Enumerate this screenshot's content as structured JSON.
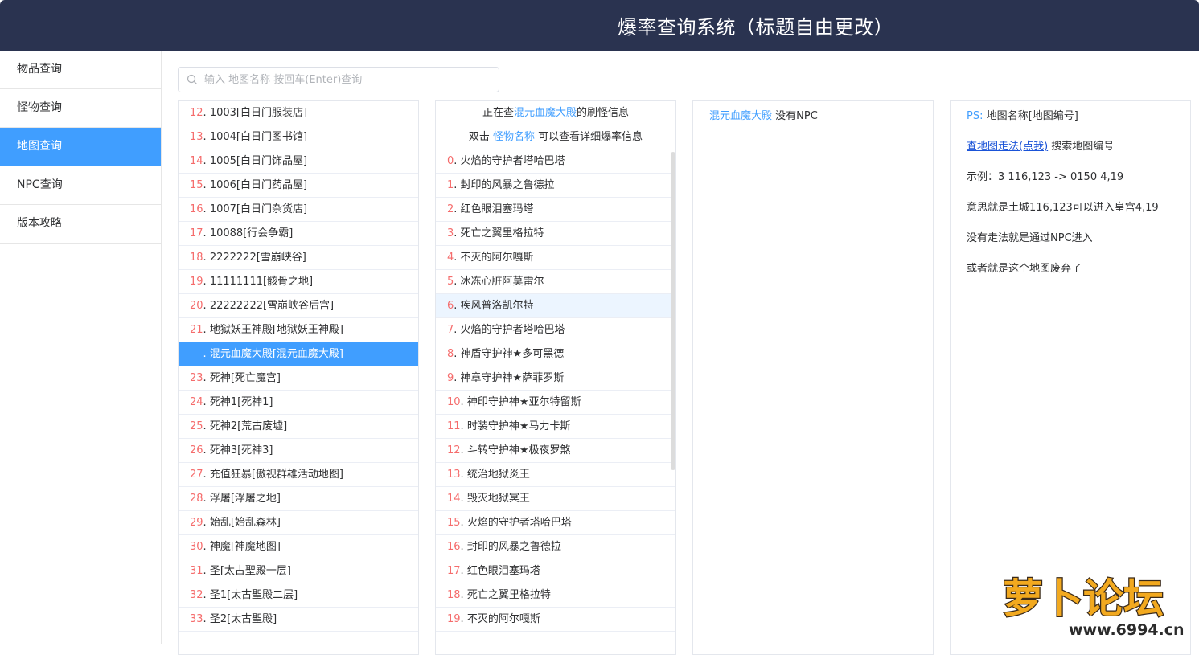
{
  "header": {
    "title": "爆率查询系统（标题自由更改）"
  },
  "sidebar": {
    "items": [
      {
        "label": "物品查询",
        "active": false
      },
      {
        "label": "怪物查询",
        "active": false
      },
      {
        "label": "地图查询",
        "active": true
      },
      {
        "label": "NPC查询",
        "active": false
      },
      {
        "label": "版本攻略",
        "active": false
      }
    ]
  },
  "search": {
    "placeholder": "输入 地图名称 按回车(Enter)查询",
    "value": ""
  },
  "map_list": {
    "selected_index": 10,
    "rows": [
      {
        "index": "12",
        "name": "1003[白日门服装店]"
      },
      {
        "index": "13",
        "name": "1004[白日门图书馆]"
      },
      {
        "index": "14",
        "name": "1005[白日门饰品屋]"
      },
      {
        "index": "15",
        "name": "1006[白日门药品屋]"
      },
      {
        "index": "16",
        "name": "1007[白日门杂货店]"
      },
      {
        "index": "17",
        "name": "10088[行会争霸]"
      },
      {
        "index": "18",
        "name": "2222222[雪崩峡谷]"
      },
      {
        "index": "19",
        "name": "11111111[骸骨之地]"
      },
      {
        "index": "20",
        "name": "22222222[雪崩峡谷后宫]"
      },
      {
        "index": "21",
        "name": "地狱妖王神殿[地狱妖王神殿]"
      },
      {
        "index": "22",
        "name": "混元血魔大殿[混元血魔大殿]"
      },
      {
        "index": "23",
        "name": "死神[死亡魔宫]"
      },
      {
        "index": "24",
        "name": "死神1[死神1]"
      },
      {
        "index": "25",
        "name": "死神2[荒古废墟]"
      },
      {
        "index": "26",
        "name": "死神3[死神3]"
      },
      {
        "index": "27",
        "name": "充值狂暴[傲视群雄活动地图]"
      },
      {
        "index": "28",
        "name": "浮屠[浮屠之地]"
      },
      {
        "index": "29",
        "name": "始乱[始乱森林]"
      },
      {
        "index": "30",
        "name": "神魔[神魔地图]"
      },
      {
        "index": "31",
        "name": "圣[太古聖殿一层]"
      },
      {
        "index": "32",
        "name": "圣1[太古聖殿二层]"
      },
      {
        "index": "33",
        "name": "圣2[太古聖殿]"
      }
    ]
  },
  "monster_panel": {
    "header1_prefix": "正在查",
    "header1_map": "混元血魔大殿",
    "header1_suffix": "的刷怪信息",
    "header2_prefix": "双击 ",
    "header2_link": "怪物名称",
    "header2_suffix": " 可以查看详细爆率信息",
    "hover_index": 6,
    "rows": [
      {
        "index": "0",
        "name": "火焰的守护者塔哈巴塔"
      },
      {
        "index": "1",
        "name": "封印的风暴之鲁德拉"
      },
      {
        "index": "2",
        "name": "红色眼泪塞玛塔"
      },
      {
        "index": "3",
        "name": "死亡之翼里格拉特"
      },
      {
        "index": "4",
        "name": "不灭的阿尔嘎斯"
      },
      {
        "index": "5",
        "name": "冰冻心脏阿莫雷尔"
      },
      {
        "index": "6",
        "name": "疾风普洛凯尔特"
      },
      {
        "index": "7",
        "name": "火焰的守护者塔哈巴塔"
      },
      {
        "index": "8",
        "name": "神盾守护神★多可黑德"
      },
      {
        "index": "9",
        "name": "神章守护神★萨菲罗斯"
      },
      {
        "index": "10",
        "name": "神印守护神★亚尔特留斯"
      },
      {
        "index": "11",
        "name": "时装守护神★马力卡斯"
      },
      {
        "index": "12",
        "name": "斗转守护神★极夜罗煞"
      },
      {
        "index": "13",
        "name": "统治地狱炎王"
      },
      {
        "index": "14",
        "name": "毁灭地狱冥王"
      },
      {
        "index": "15",
        "name": "火焰的守护者塔哈巴塔"
      },
      {
        "index": "16",
        "name": "封印的风暴之鲁德拉"
      },
      {
        "index": "17",
        "name": "红色眼泪塞玛塔"
      },
      {
        "index": "18",
        "name": "死亡之翼里格拉特"
      },
      {
        "index": "19",
        "name": "不灭的阿尔嘎斯"
      }
    ]
  },
  "npc_panel": {
    "map_name": "混元血魔大殿",
    "text": " 没有NPC"
  },
  "ps_panel": {
    "ps_label": "PS:",
    "line1": " 地图名称[地图编号]",
    "link": "查地图走法(点我)",
    "line2_suffix": " 搜索地图编号",
    "line3": "示例：3 116,123 -> 0150 4,19",
    "line4": "意思就是土城116,123可以进入皇宫4,19",
    "line5": "没有走法就是通过NPC进入",
    "line6": "或者就是这个地图废弃了"
  },
  "watermark": {
    "text": "萝卜论坛",
    "site": "www.6994.cn"
  },
  "colors": {
    "header_bg": "#2a3350",
    "accent": "#409eff",
    "index_red": "#f56c6c",
    "link": "#1a53d8"
  }
}
